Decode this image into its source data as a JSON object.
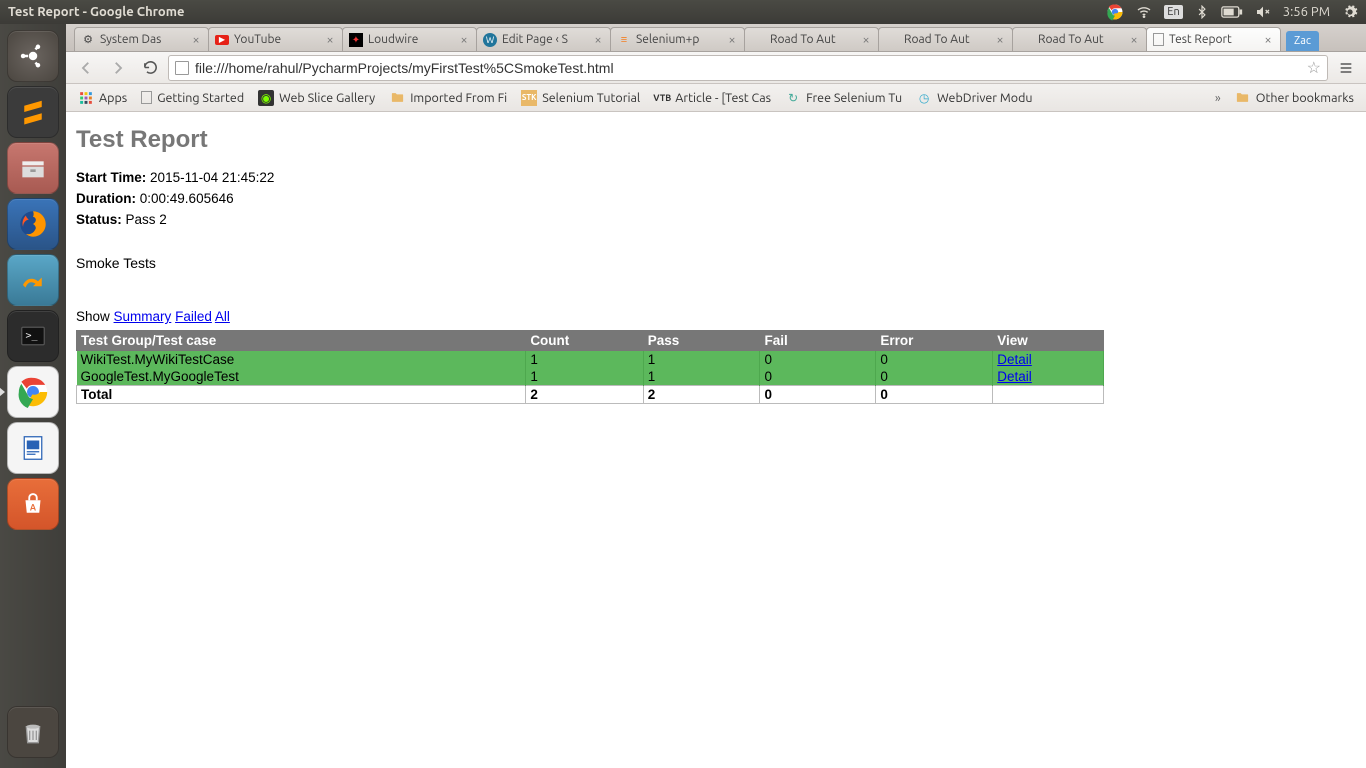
{
  "window_title": "Test Report - Google Chrome",
  "panel": {
    "lang": "En",
    "time": "3:56 PM"
  },
  "tabs": [
    {
      "label": "System Das",
      "icon": "sys"
    },
    {
      "label": "YouTube",
      "icon": "yt"
    },
    {
      "label": "Loudwire",
      "icon": "lw"
    },
    {
      "label": "Edit Page ‹ S",
      "icon": "wp"
    },
    {
      "label": "Selenium+p",
      "icon": "so"
    },
    {
      "label": "Road To Aut",
      "icon": ""
    },
    {
      "label": "Road To Aut",
      "icon": ""
    },
    {
      "label": "Road To Aut",
      "icon": ""
    },
    {
      "label": "Test Report",
      "icon": "file",
      "active": true
    }
  ],
  "user_badge": "Zac",
  "url": "file:///home/rahul/PycharmProjects/myFirstTest%5CSmokeTest.html",
  "bookmarks": {
    "apps": "Apps",
    "items": [
      {
        "label": "Getting Started",
        "icon": "file"
      },
      {
        "label": "Web Slice Gallery",
        "icon": "slice"
      },
      {
        "label": "Imported From Fi",
        "icon": "folder"
      },
      {
        "label": "Selenium Tutorial",
        "icon": "stk"
      },
      {
        "label": "Article - [Test Cas",
        "icon": "vtb"
      },
      {
        "label": "Free Selenium Tu",
        "icon": "g"
      },
      {
        "label": "WebDriver Modu",
        "icon": "wd"
      }
    ],
    "other": "Other bookmarks"
  },
  "report": {
    "title": "Test Report",
    "start_label": "Start Time:",
    "start_value": "2015-11-04 21:45:22",
    "duration_label": "Duration:",
    "duration_value": "0:00:49.605646",
    "status_label": "Status:",
    "status_value": "Pass 2",
    "section": "Smoke Tests",
    "show_label": "Show",
    "show_links": {
      "summary": "Summary",
      "failed": "Failed",
      "all": "All"
    },
    "headers": {
      "name": "Test Group/Test case",
      "count": "Count",
      "pass": "Pass",
      "fail": "Fail",
      "error": "Error",
      "view": "View"
    },
    "rows": [
      {
        "name": "WikiTest.MyWikiTestCase",
        "count": "1",
        "pass": "1",
        "fail": "0",
        "error": "0",
        "view": "Detail"
      },
      {
        "name": "GoogleTest.MyGoogleTest",
        "count": "1",
        "pass": "1",
        "fail": "0",
        "error": "0",
        "view": "Detail"
      }
    ],
    "total": {
      "label": "Total",
      "count": "2",
      "pass": "2",
      "fail": "0",
      "error": "0"
    }
  }
}
